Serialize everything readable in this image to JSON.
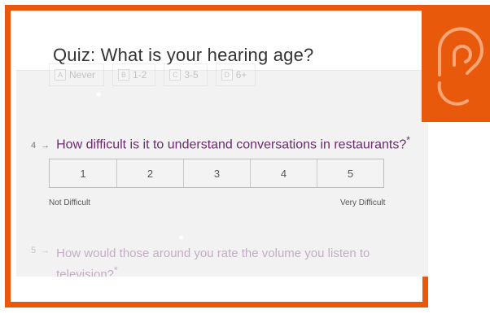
{
  "quiz": {
    "title": "Quiz: What is your hearing age?"
  },
  "previous_question": {
    "options": [
      {
        "key": "A",
        "label": "Never"
      },
      {
        "key": "B",
        "label": "1-2"
      },
      {
        "key": "C",
        "label": "3-5"
      },
      {
        "key": "D",
        "label": "6+"
      }
    ]
  },
  "question4": {
    "number": "4",
    "arrow": "→",
    "text": "How difficult is it to understand conversations in restaurants?",
    "required_mark": "*",
    "scale": [
      "1",
      "2",
      "3",
      "4",
      "5"
    ],
    "label_left": "Not Difficult",
    "label_right": "Very Difficult"
  },
  "question5": {
    "number": "5",
    "arrow": "→",
    "text": "How would those around you rate the volume you listen to television?",
    "required_mark": "*"
  },
  "colors": {
    "accent": "#e8590c",
    "question": "#6b2b6d"
  },
  "icons": {
    "badge": "ear-icon"
  }
}
